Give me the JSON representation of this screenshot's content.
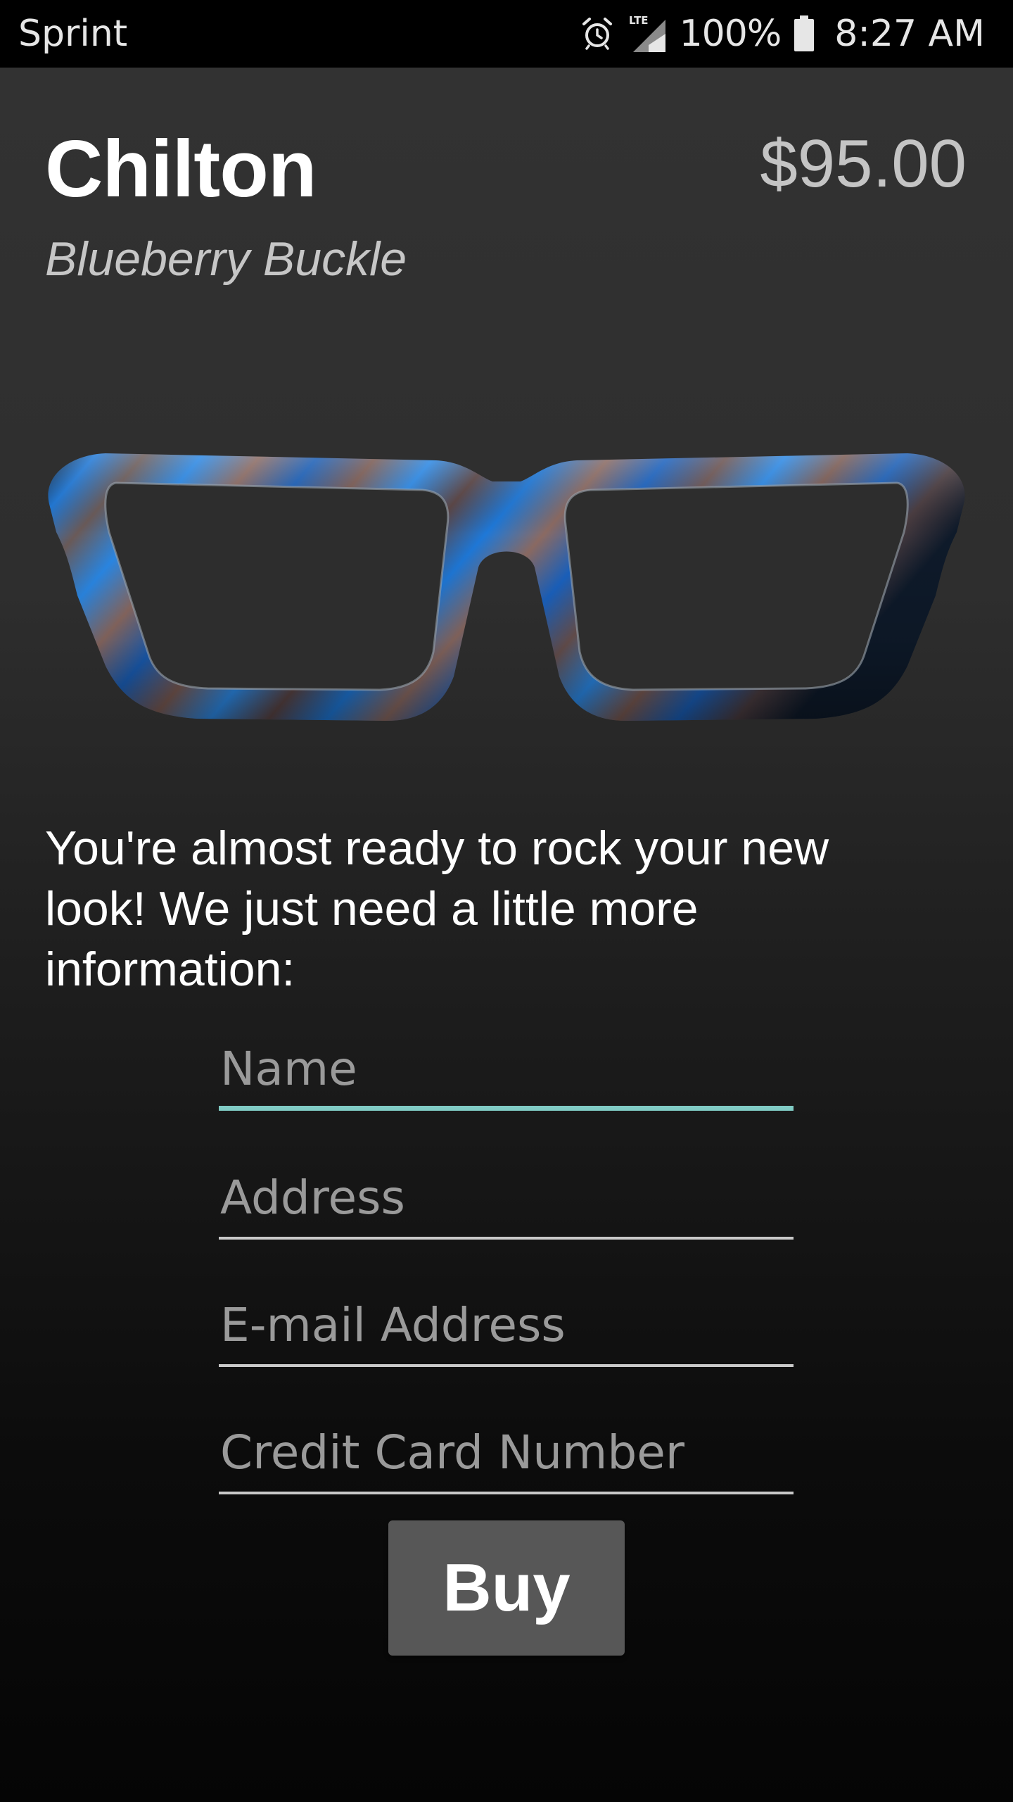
{
  "status_bar": {
    "carrier": "Sprint",
    "network_label": "LTE",
    "battery_percent": "100%",
    "time": "8:27 AM",
    "icons": [
      "alarm-icon",
      "lte-signal-icon",
      "battery-icon"
    ]
  },
  "product": {
    "name": "Chilton",
    "color_name": "Blueberry Buckle",
    "price": "$95.00",
    "image_icon": "eyeglasses-image"
  },
  "checkout": {
    "intro": "You're almost ready to rock your new look! We just need a little more information:",
    "fields": {
      "name": {
        "placeholder": "Name",
        "value": ""
      },
      "address": {
        "placeholder": "Address",
        "value": ""
      },
      "email": {
        "placeholder": "E-mail Address",
        "value": ""
      },
      "card": {
        "placeholder": "Credit Card Number",
        "value": ""
      }
    },
    "buy_label": "Buy"
  },
  "colors": {
    "focus_accent": "#80cbc4",
    "button_bg": "#575757",
    "frame_blue": "#1e78d8",
    "frame_brown": "#7a5a52"
  }
}
